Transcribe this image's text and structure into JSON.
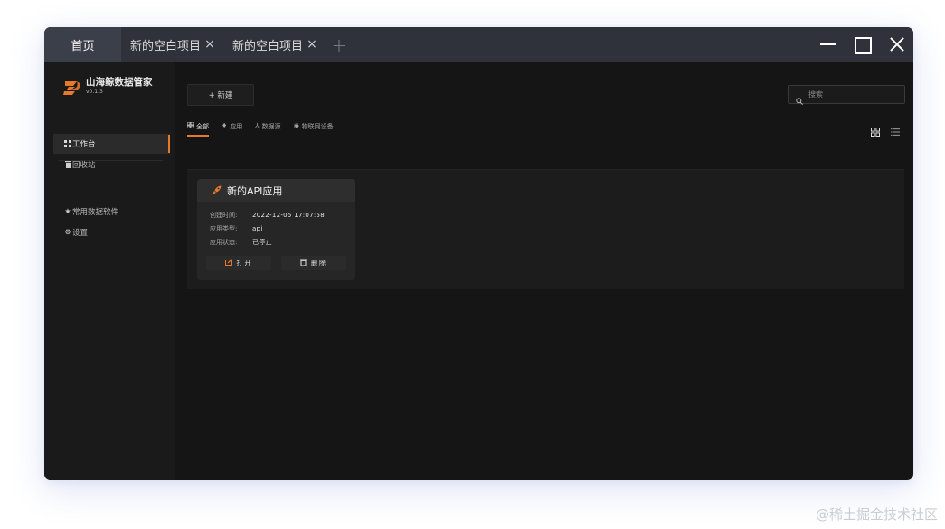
{
  "titlebar": {
    "home_tab": "首页",
    "tabs": [
      {
        "label": "新的空白项目"
      },
      {
        "label": "新的空白项目"
      }
    ],
    "close_glyph": "×",
    "add_glyph": "+"
  },
  "sidebar": {
    "brand_name": "山海鲸数据管家",
    "version": "v0.1.3",
    "items": [
      {
        "label": "工作台",
        "icon": "grid-icon",
        "active": true
      },
      {
        "label": "回收站",
        "icon": "trash-icon",
        "active": false
      }
    ],
    "bottom_items": [
      {
        "label": "常用数据软件",
        "icon": "star-icon"
      },
      {
        "label": "设置",
        "icon": "gear-icon"
      }
    ]
  },
  "main": {
    "new_button": "+ 新建",
    "search_placeholder": "搜索",
    "filter_tabs": [
      {
        "label": "全部",
        "icon": "grid-icon",
        "active": true
      },
      {
        "label": "应用",
        "icon": "rocket-icon",
        "active": false
      },
      {
        "label": "数据源",
        "icon": "network-icon",
        "active": false
      },
      {
        "label": "物联网设备",
        "icon": "iot-icon",
        "active": false
      }
    ],
    "cards": [
      {
        "title": "新的API应用",
        "fields": [
          {
            "key": "创建时间:",
            "value": "2022-12-05 17:07:58"
          },
          {
            "key": "应用类型:",
            "value": "api"
          },
          {
            "key": "应用状态:",
            "value": "已停止"
          }
        ],
        "open_label": "打开",
        "delete_label": "删除"
      }
    ]
  },
  "watermark": "@稀土掘金技术社区",
  "colors": {
    "accent": "#e57a2c",
    "titlebar": "#2f323b",
    "window_bg": "#151515"
  }
}
